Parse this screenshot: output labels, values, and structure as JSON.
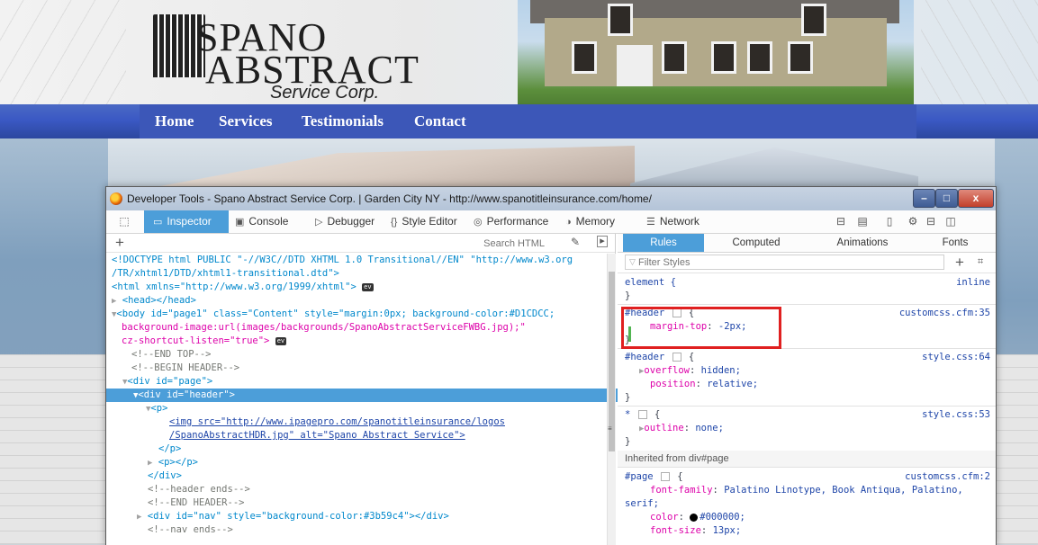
{
  "site": {
    "logo": {
      "line1": "SPANO",
      "line2": "ABSTRACT",
      "line3": "Service Corp."
    },
    "nav": [
      "Home",
      "Services",
      "Testimonials",
      "Contact"
    ],
    "nav_color": "#3b59c4"
  },
  "devtools": {
    "title": "Developer Tools - Spano Abstract Service Corp. | Garden City NY - http://www.spanotitleinsurance.com/home/",
    "window_buttons": {
      "minimize": "–",
      "maximize": "□",
      "close": "x"
    },
    "toolbar": {
      "tabs": [
        {
          "label": "Inspector",
          "icon": "inspector-icon",
          "active": true
        },
        {
          "label": "Console",
          "icon": "console-icon"
        },
        {
          "label": "Debugger",
          "icon": "debugger-icon"
        },
        {
          "label": "Style Editor",
          "icon": "style-editor-icon"
        },
        {
          "label": "Performance",
          "icon": "performance-icon"
        },
        {
          "label": "Memory",
          "icon": "memory-icon"
        },
        {
          "label": "Network",
          "icon": "network-icon"
        }
      ],
      "accent": "#4c9ed9"
    },
    "markup": {
      "search_placeholder": "Search HTML",
      "lines": [
        "<!DOCTYPE html PUBLIC \"-//W3C//DTD XHTML 1.0 Transitional//EN\" \"http://www.w3.org",
        "/TR/xhtml1/DTD/xhtml1-transitional.dtd\">",
        "<html xmlns=\"http://www.w3.org/1999/xhtml\">",
        "<head></head>",
        "<body id=\"page1\" class=\"Content\" style=\"margin:0px; background-color:#D1CDCC;",
        "background-image:url(images/backgrounds/SpanoAbstractServiceFWBG.jpg);\"",
        "cz-shortcut-listen=\"true\">",
        "<!--END TOP-->",
        "<!--BEGIN HEADER-->",
        "<div id=\"page\">",
        "<div id=\"header\">",
        "<p>",
        "<img src=\"http://www.ipagepro.com/spanotitleinsurance/logos",
        "/SpanoAbstractHDR.jpg\" alt=\"Spano Abstract Service\">",
        "</p>",
        "<p></p>",
        "</div>",
        "<!--header ends-->",
        "<!--END HEADER-->",
        "<div id=\"nav\" style=\"background-color:#3b59c4\"></div>",
        "<!--nav ends-->"
      ],
      "ev_badge": "ev",
      "selected_line": "<div id=\"header\">"
    },
    "rules_pane": {
      "tabs": [
        "Rules",
        "Computed",
        "Animations",
        "Fonts"
      ],
      "filter_placeholder": "Filter Styles",
      "element_rule": {
        "selector": "element {",
        "source": "inline",
        "close": "}"
      },
      "rules": [
        {
          "selector": "#header",
          "source": "customcss.cfm:35",
          "declarations": [
            {
              "prop": "margin-top",
              "value": "-2px;"
            }
          ],
          "highlighted": true
        },
        {
          "selector": "#header",
          "source": "style.css:64",
          "declarations": [
            {
              "prop": "overflow",
              "value": "hidden;",
              "expandable": true
            },
            {
              "prop": "position",
              "value": "relative;"
            }
          ]
        },
        {
          "selector": "*",
          "source": "style.css:53",
          "declarations": [
            {
              "prop": "outline",
              "value": "none;",
              "expandable": true
            }
          ]
        }
      ],
      "inherited_header": "Inherited from div#page",
      "page_rule": {
        "selector": "#page",
        "source": "customcss.cfm:2",
        "font_family_prop": "font-family",
        "font_family_value": "Palatino Linotype, Book Antiqua, Palatino,",
        "font_family_cont": "serif;",
        "color_prop": "color",
        "color_value": "#000000;",
        "font_size_prop": "font-size",
        "font_size_value": "13px;"
      }
    }
  }
}
